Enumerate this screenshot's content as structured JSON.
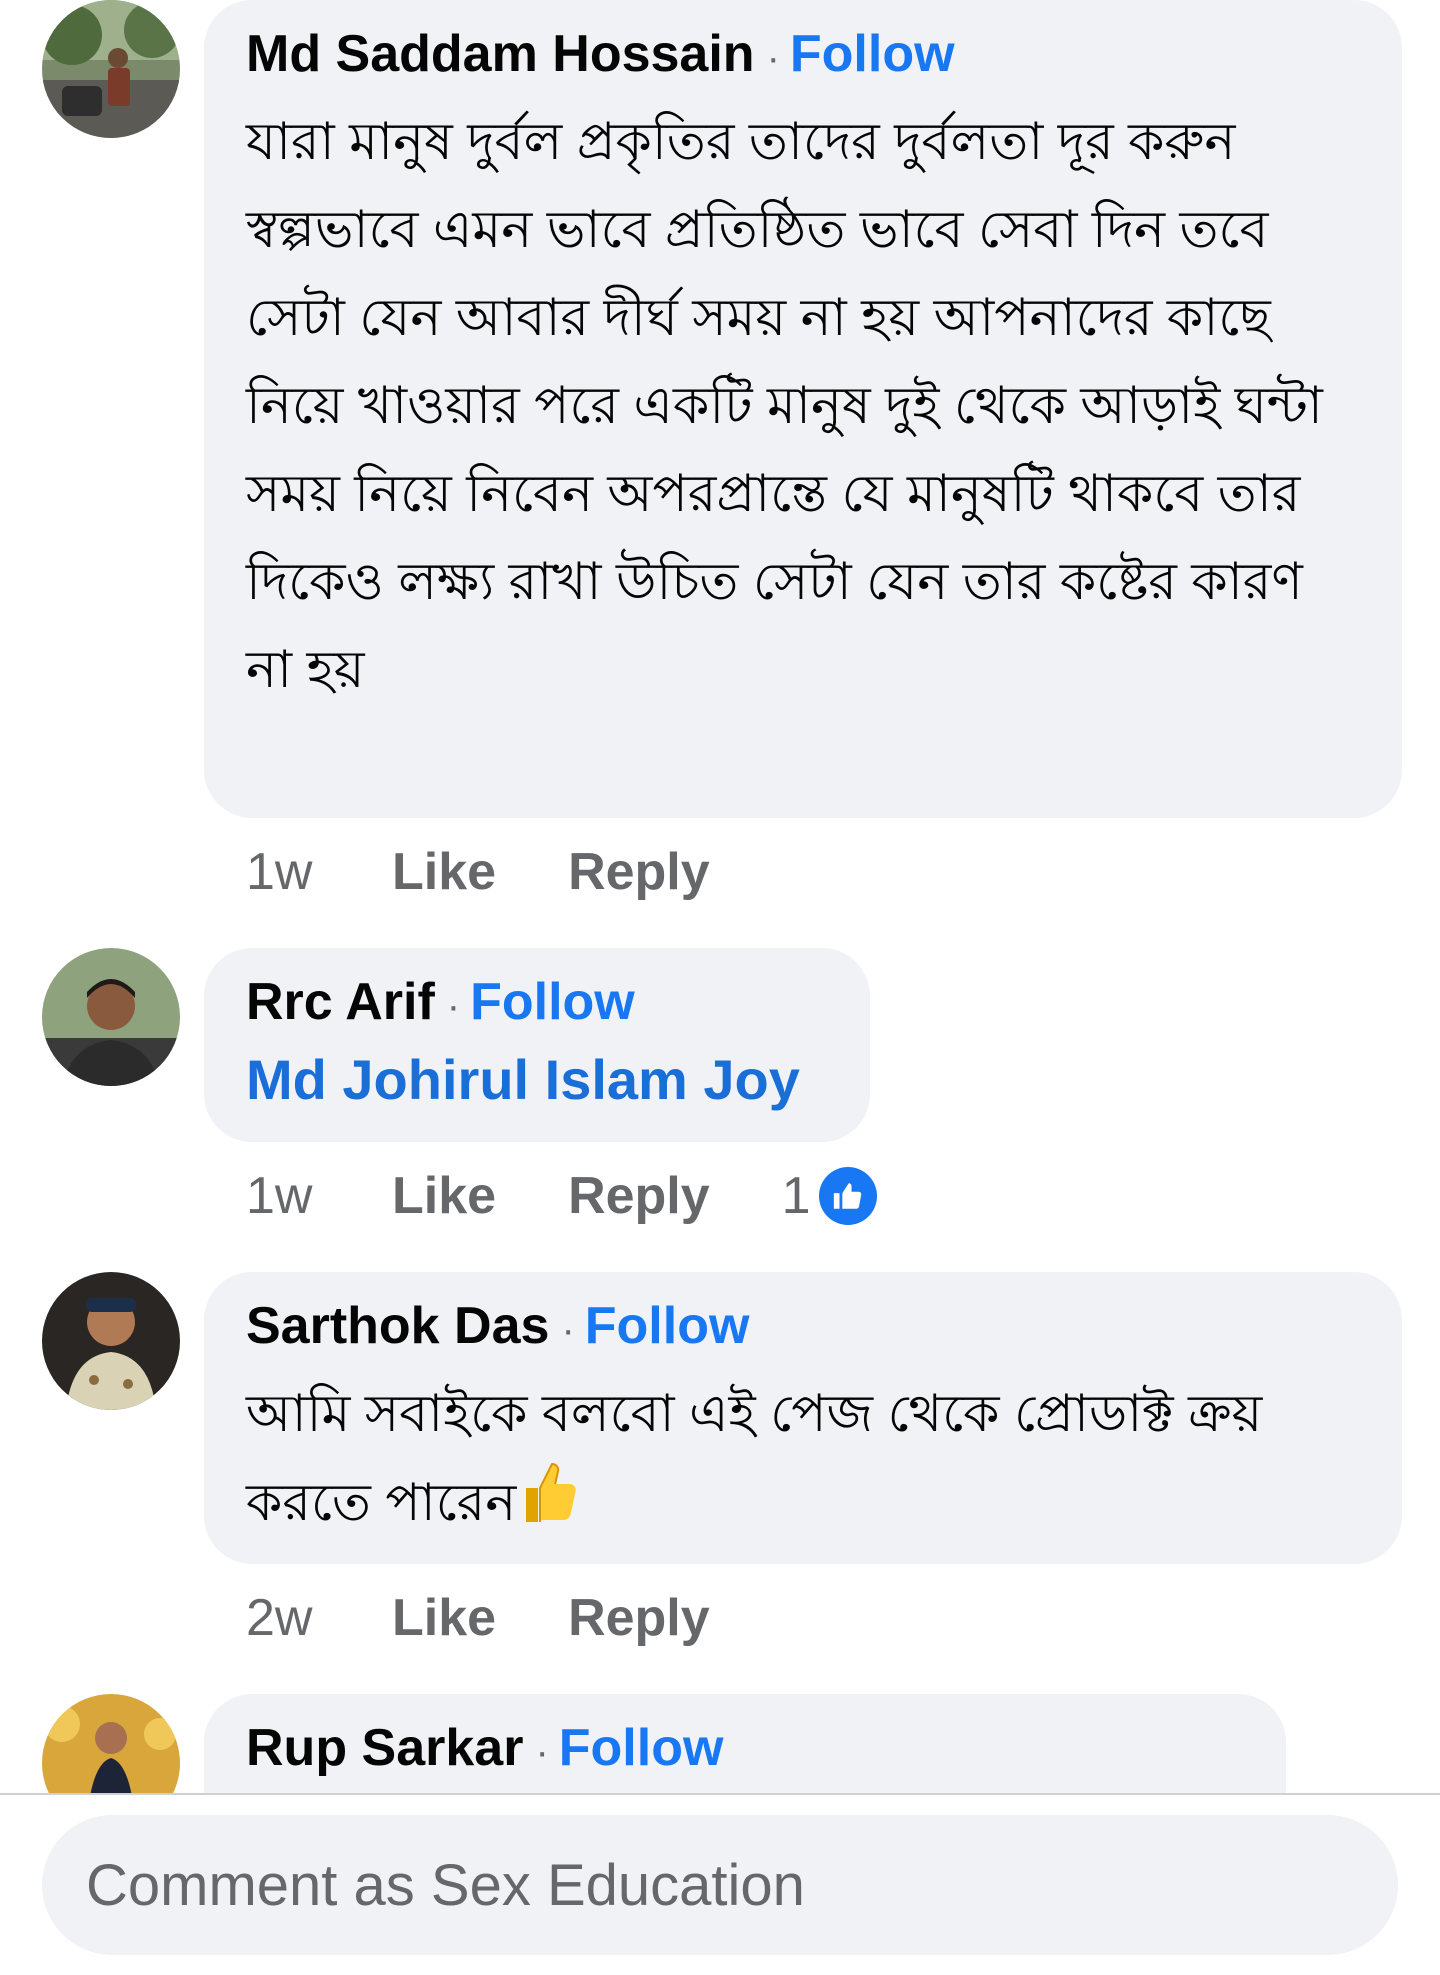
{
  "comments": [
    {
      "author": "Md Saddam Hossain",
      "separator": "·",
      "follow_label": "Follow",
      "text": "যারা মানুষ দুর্বল প্রকৃতির তাদের দুর্বলতা দূর করুন স্বল্পভাবে এমন ভাবে প্রতিষ্ঠিত ভাবে সেবা দিন তবে সেটা যেন আবার দীর্ঘ সময় না হয় আপনাদের কাছে নিয়ে খাওয়ার পরে একটি মানুষ দুই থেকে আড়াই ঘন্টা সময় নিয়ে নিবেন অপরপ্রান্তে যে মানুষটি থাকবে তার দিকেও লক্ষ্য রাখা উচিত সেটা যেন তার কষ্টের কারণ না হয়",
      "time": "1w",
      "like_label": "Like",
      "reply_label": "Reply"
    },
    {
      "author": "Rrc Arif",
      "separator": "·",
      "follow_label": "Follow",
      "tagged_name": "Md Johirul Islam Joy",
      "time": "1w",
      "like_label": "Like",
      "reply_label": "Reply",
      "reaction_count": "1",
      "reaction_icon": "like-thumb-icon"
    },
    {
      "author": "Sarthok Das",
      "separator": "·",
      "follow_label": "Follow",
      "text": "আমি সবাইকে বলবো এই পেজ থেকে প্রোডাক্ট ক্রয় করতে পারেন",
      "emoji": "thumbs-up-emoji",
      "time": "2w",
      "like_label": "Like",
      "reply_label": "Reply"
    },
    {
      "author": "Rup Sarkar",
      "separator": "·",
      "follow_label": "Follow"
    }
  ],
  "composer": {
    "placeholder": "Comment as Sex Education"
  },
  "colors": {
    "bubble": "#f0f2f5",
    "link": "#1877f2",
    "muted": "#65676b",
    "text": "#050505"
  }
}
